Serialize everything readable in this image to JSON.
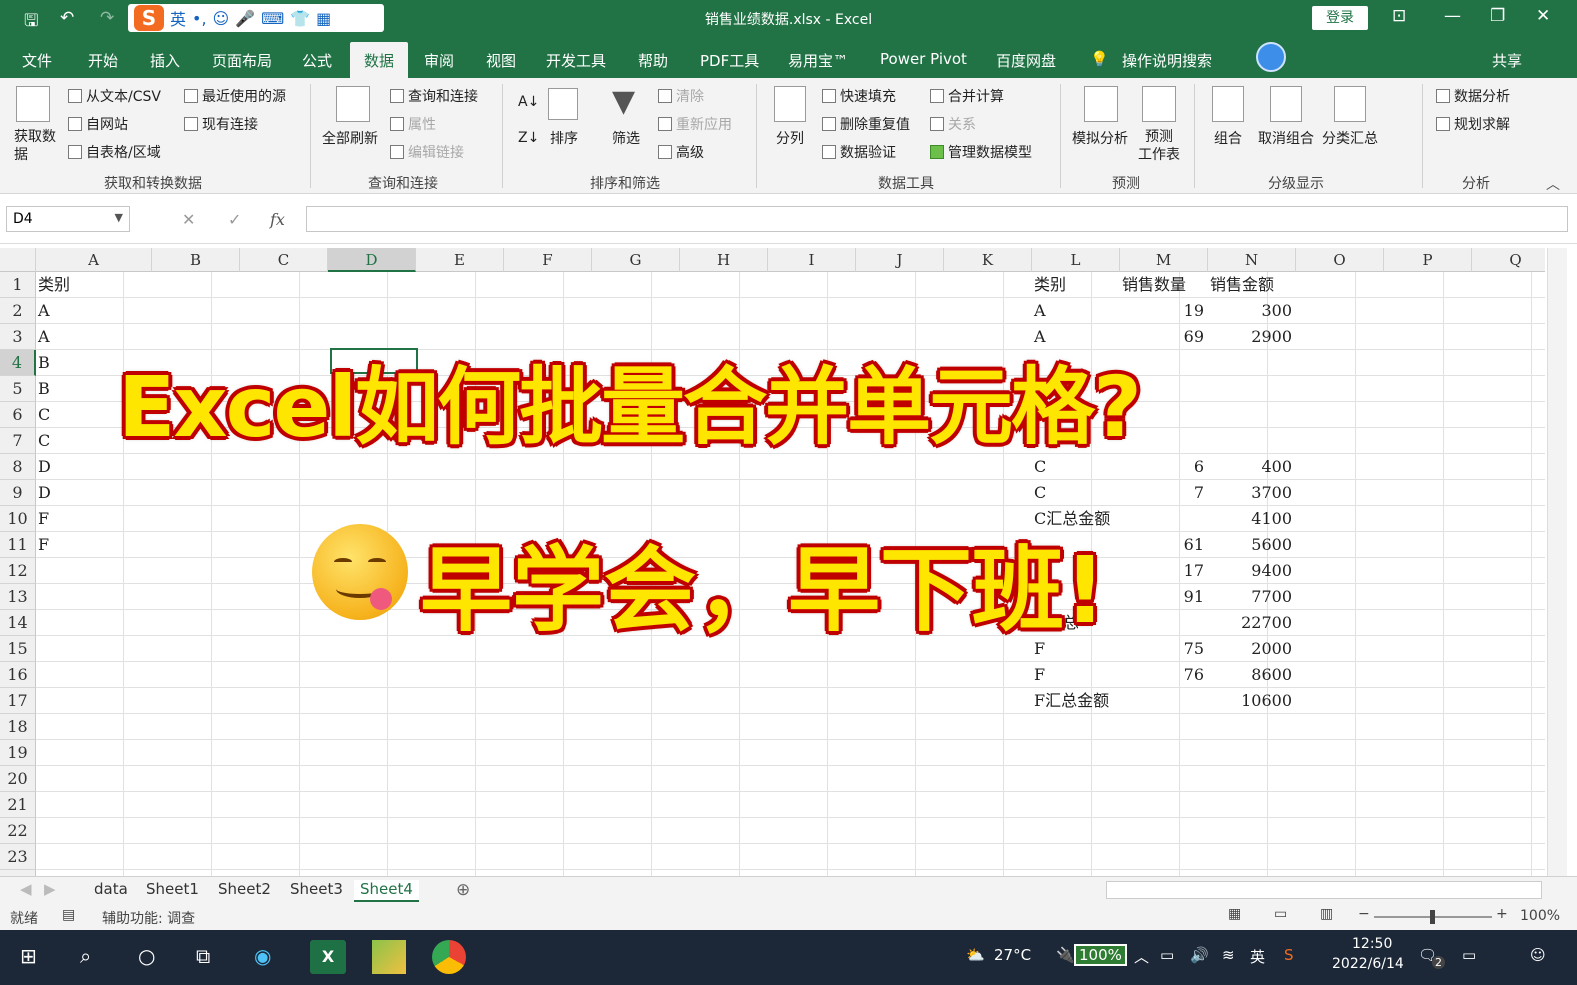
{
  "title_bar": {
    "title": "销售业绩数据.xlsx  -  Excel",
    "login": "登录",
    "ime_lang": "英"
  },
  "menu_tabs": [
    "文件",
    "开始",
    "插入",
    "页面布局",
    "公式",
    "数据",
    "审阅",
    "视图",
    "开发工具",
    "帮助",
    "PDF工具",
    "易用宝™",
    "Power Pivot",
    "百度网盘"
  ],
  "active_tab": "数据",
  "tell_me": "操作说明搜索",
  "share": "共享",
  "ribbon": {
    "get_data": "获取数据",
    "from_text": "从文本/CSV",
    "from_web": "自网站",
    "from_table": "自表格/区域",
    "recent_sources": "最近使用的源",
    "existing_conn": "现有连接",
    "group_get": "获取和转换数据",
    "refresh_all": "全部刷新",
    "queries_conn": "查询和连接",
    "properties": "属性",
    "edit_links": "编辑链接",
    "group_query": "查询和连接",
    "sort": "排序",
    "filter": "筛选",
    "clear": "清除",
    "reapply": "重新应用",
    "advanced": "高级",
    "group_sort": "排序和筛选",
    "text_to_col": "分列",
    "flash_fill": "快速填充",
    "remove_dup": "删除重复值",
    "data_valid": "数据验证",
    "consolidate": "合并计算",
    "relations": "关系",
    "data_model": "管理数据模型",
    "group_tools": "数据工具",
    "whatif": "模拟分析",
    "forecast": "预测\n工作表",
    "group_forecast": "预测",
    "group_btn": "组合",
    "ungroup": "取消组合",
    "subtotal": "分类汇总",
    "group_outline": "分级显示",
    "data_analysis": "数据分析",
    "solver": "规划求解",
    "group_analysis": "分析"
  },
  "formula_bar": {
    "name_box": "D4",
    "fx": "fx"
  },
  "columns": [
    "A",
    "B",
    "C",
    "D",
    "E",
    "F",
    "G",
    "H",
    "I",
    "J",
    "K",
    "L",
    "M",
    "N",
    "O",
    "P",
    "Q"
  ],
  "rows": [
    "1",
    "2",
    "3",
    "4",
    "5",
    "6",
    "7",
    "8",
    "9",
    "10",
    "11",
    "12",
    "13",
    "14",
    "15",
    "16",
    "17",
    "18",
    "19",
    "20",
    "21",
    "22",
    "23",
    "24"
  ],
  "colA": [
    "类别",
    "A",
    "A",
    "B",
    "B",
    "C",
    "C",
    "D",
    "D",
    "F",
    "F"
  ],
  "right_table": [
    [
      "类别",
      "销售数量",
      "销售金额"
    ],
    [
      "A",
      "19",
      "300"
    ],
    [
      "A",
      "69",
      "2900"
    ],
    [
      "",
      "",
      ""
    ],
    [
      "",
      "",
      ""
    ],
    [
      "",
      "",
      ""
    ],
    [
      "",
      "",
      ""
    ],
    [
      "C",
      "6",
      "400"
    ],
    [
      "C",
      "7",
      "3700"
    ],
    [
      "C汇总金额",
      "",
      "4100"
    ],
    [
      "",
      "61",
      "5600"
    ],
    [
      "",
      "17",
      "9400"
    ],
    [
      "D",
      "91",
      "7700"
    ],
    [
      "D汇总",
      "",
      "22700"
    ],
    [
      "F",
      "75",
      "2000"
    ],
    [
      "F",
      "76",
      "8600"
    ],
    [
      "F汇总金额",
      "",
      "10600"
    ]
  ],
  "overlay": {
    "line1": "Excel如何批量合并单元格?",
    "line2": "早学会，早下班!"
  },
  "sheets": [
    "data",
    "Sheet1",
    "Sheet2",
    "Sheet3",
    "Sheet4"
  ],
  "active_sheet": "Sheet4",
  "status": {
    "ready": "就绪",
    "accessibility": "辅助功能: 调查",
    "zoom": "100%"
  },
  "taskbar": {
    "weather": "27°C",
    "battery": "100%",
    "lang": "英",
    "time": "12:50",
    "date": "2022/6/14",
    "notif": "2"
  }
}
